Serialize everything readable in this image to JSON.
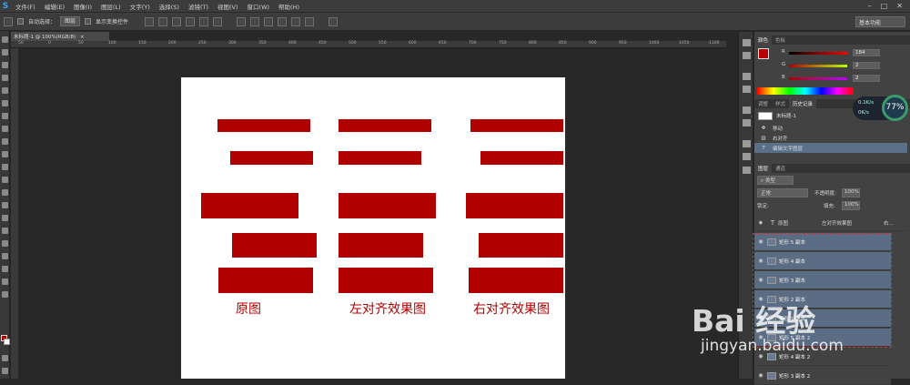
{
  "menu": {
    "items": [
      "文件(F)",
      "编辑(E)",
      "图像(I)",
      "图层(L)",
      "文字(Y)",
      "选择(S)",
      "滤镜(T)",
      "视图(V)",
      "窗口(W)",
      "帮助(H)"
    ],
    "win_min": "–",
    "win_max": "□",
    "win_close": "✕"
  },
  "options": {
    "auto_select": "自动选择：",
    "auto_select_value": "图层",
    "show_transform": "显示变换控件",
    "workspace": "基本功能"
  },
  "document": {
    "tab_title": "未标题-1 @ 100%(RGB/8)",
    "tab_close": "×",
    "ruler_ticks": [
      "50",
      "0",
      "50",
      "100",
      "150",
      "200",
      "250",
      "300",
      "350",
      "400",
      "450",
      "500",
      "550",
      "600",
      "650",
      "700",
      "750",
      "800",
      "850",
      "900",
      "950",
      "1000",
      "1050",
      "1100"
    ]
  },
  "canvas": {
    "labels": [
      "原图",
      "左对齐效果图",
      "右对齐效果图"
    ]
  },
  "color_panel": {
    "tabs": [
      "颜色",
      "色板"
    ],
    "channels": [
      {
        "label": "R",
        "value": "184"
      },
      {
        "label": "G",
        "value": "2"
      },
      {
        "label": "B",
        "value": "2"
      }
    ],
    "foreground": "#b80202"
  },
  "history_panel": {
    "tabs": [
      "调整",
      "样式",
      "历史记录"
    ],
    "snapshot": "未标题-1",
    "items": [
      "移动",
      "右对齐",
      "编辑文字图层"
    ]
  },
  "speed_widget": {
    "up": "0.1K/s",
    "down": "0K/s",
    "percent": "77%"
  },
  "layers_panel": {
    "tabs": [
      "图层",
      "通道"
    ],
    "kind_filter": "类型",
    "blend_mode": "正常",
    "opacity_label": "不透明度:",
    "opacity_value": "100%",
    "lock_label": "锁定:",
    "fill_label": "填充:",
    "fill_value": "100%",
    "text_layer_labels": [
      "原图",
      "左对齐效果图",
      "右..."
    ],
    "layers": [
      "矩形 5 副本",
      "矩形 4 副本",
      "矩形 3 副本",
      "矩形 2 副本",
      "矩形 1 副本",
      "矩形 5 副本 2",
      "矩形 4 副本 2",
      "矩形 3 副本 2"
    ]
  },
  "watermark": {
    "text": "Bai 经验",
    "url": "jingyan.baidu.com"
  }
}
